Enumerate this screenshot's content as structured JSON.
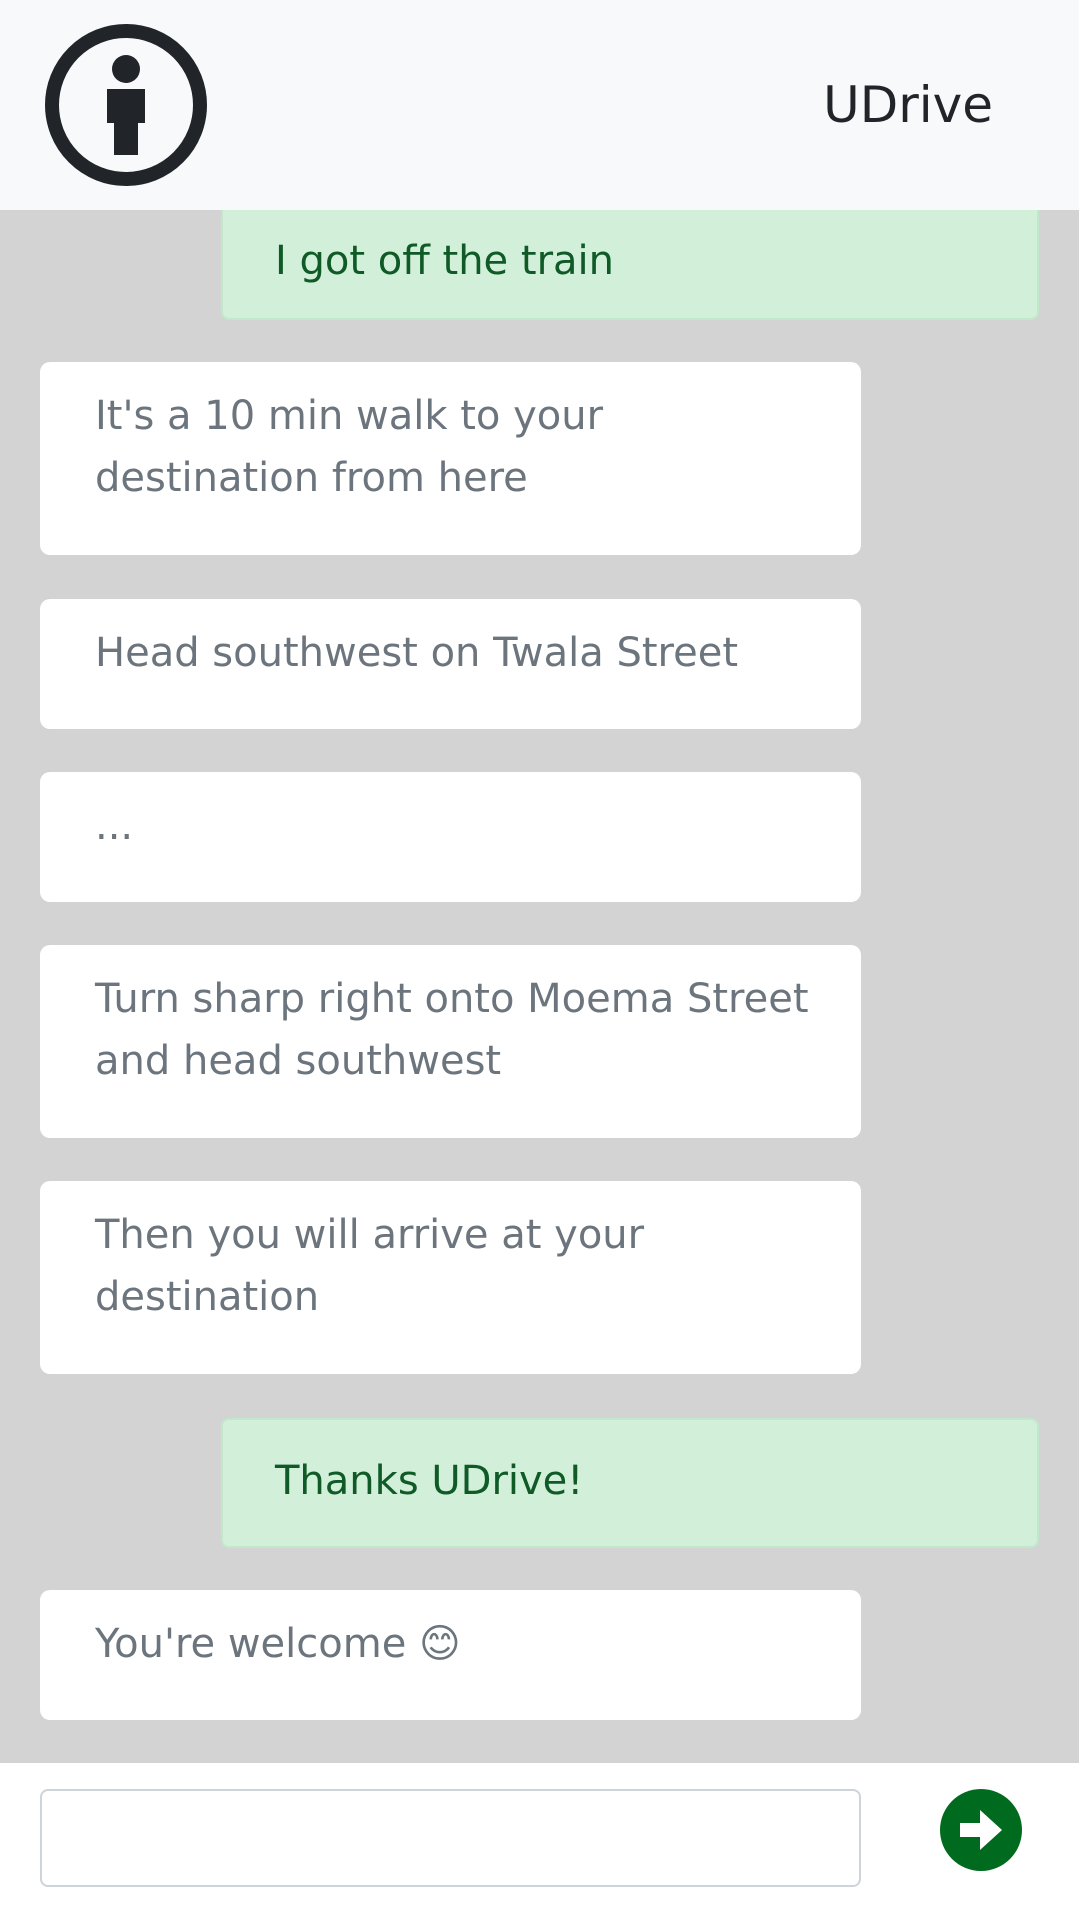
{
  "header": {
    "logo_icon": "info-person-icon",
    "brand": "UDrive"
  },
  "messages": [
    {
      "sender": "user",
      "text": "I got off the train"
    },
    {
      "sender": "bot",
      "text": "It's a 10 min walk to your destination from here"
    },
    {
      "sender": "bot",
      "text": "Head southwest on Twala Street"
    },
    {
      "sender": "bot",
      "text": "..."
    },
    {
      "sender": "bot",
      "text": "Turn sharp right onto Moema Street and head southwest"
    },
    {
      "sender": "bot",
      "text": "Then you will arrive at your destination"
    },
    {
      "sender": "user",
      "text": "Thanks UDrive!"
    },
    {
      "sender": "bot",
      "text": "You're welcome 😊"
    }
  ],
  "composer": {
    "value": "",
    "placeholder": "",
    "send_icon": "arrow-right-circle-icon"
  },
  "colors": {
    "chat_background": "#d3d3d3",
    "bot_bubble": "#ffffff",
    "user_bubble": "#d1efd9",
    "user_text": "#0f5a26",
    "send_button": "#006b1f"
  }
}
